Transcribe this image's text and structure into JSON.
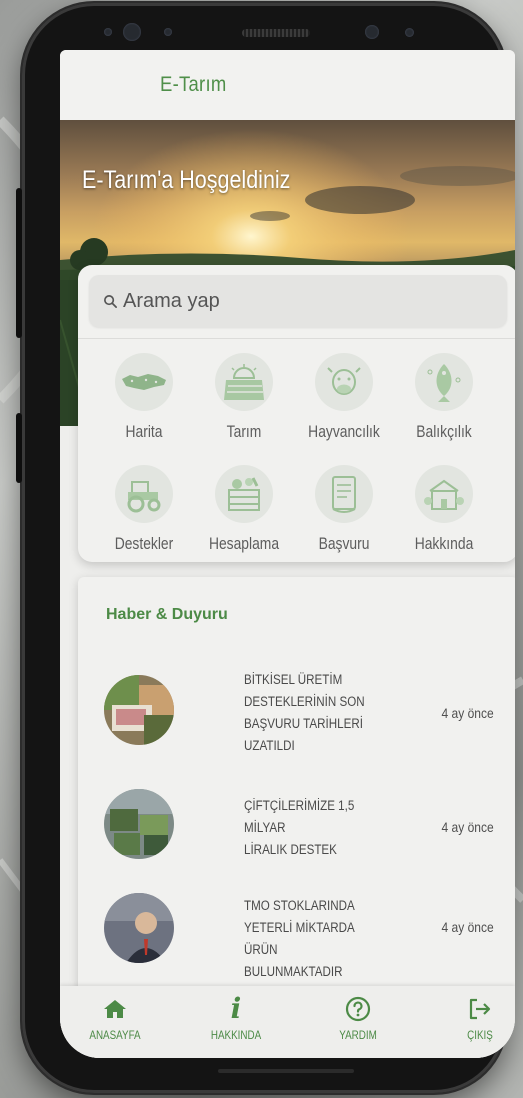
{
  "app": {
    "title": "E-Tarım"
  },
  "hero": {
    "title": "E-Tarım'a Hoşgeldiniz"
  },
  "search": {
    "placeholder": "Arama yap"
  },
  "categories": [
    {
      "label": "Harita",
      "icon": "turkey-map-icon"
    },
    {
      "label": "Tarım",
      "icon": "field-sun-icon"
    },
    {
      "label": "Hayvancılık",
      "icon": "cow-icon"
    },
    {
      "label": "Balıkçılık",
      "icon": "fish-icon"
    },
    {
      "label": "Destekler",
      "icon": "tractor-icon"
    },
    {
      "label": "Hesaplama",
      "icon": "vegetable-crate-icon"
    },
    {
      "label": "Başvuru",
      "icon": "document-scroll-icon"
    },
    {
      "label": "Hakkında",
      "icon": "farmhouse-icon"
    }
  ],
  "news": {
    "title": "Haber & Duyuru",
    "items": [
      {
        "lines": [
          "BİTKİSEL ÜRETİM",
          "DESTEKLERİNİN SON",
          "BAŞVURU TARİHLERİ",
          "UZATILDI"
        ],
        "time": "4 ay önce"
      },
      {
        "lines": [
          "ÇİFTÇİLERİMİZE 1,5 MİLYAR",
          "LİRALIK DESTEK"
        ],
        "time": "4 ay önce"
      },
      {
        "lines": [
          "TMO STOKLARINDA",
          "YETERLİ MİKTARDA ÜRÜN",
          "BULUNMAKTADIR"
        ],
        "time": "4 ay önce"
      }
    ]
  },
  "bottom_nav": [
    {
      "label": "ANASAYFA",
      "icon": "home-icon"
    },
    {
      "label": "HAKKINDA",
      "icon": "info-icon"
    },
    {
      "label": "YARDIM",
      "icon": "help-icon"
    },
    {
      "label": "ÇIKIŞ",
      "icon": "logout-icon"
    }
  ],
  "colors": {
    "accent": "#4c8a46",
    "background": "#eeeeec",
    "icon_bg": "#e2e5e0"
  }
}
